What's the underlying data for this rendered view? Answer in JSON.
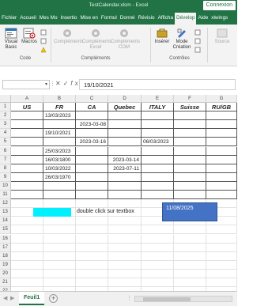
{
  "window": {
    "title": "TestCalendar.xlsm - Excel",
    "connect_label": "Connexion"
  },
  "tabs": [
    "Fichier",
    "Accueil",
    "Mes Mo",
    "Insertio",
    "Mise en",
    "Formul",
    "Donné",
    "Révisio",
    "Afficha",
    "Dévelop",
    "Aide",
    "xlwings"
  ],
  "active_tab": "Dévelop",
  "ribbon": {
    "visual_basic": "Visual Basic",
    "macros": "Macros",
    "group_code": "Code",
    "complements": "Compléments",
    "complements_excel": "Compléments Excel",
    "complements_com": "Compléments COM",
    "group_complements": "Compléments",
    "inserer": "Insérer",
    "mode_creation": "Mode Création",
    "group_controles": "Contrôles",
    "source": "Source"
  },
  "formula_bar": {
    "name_box": "",
    "fx": "fx",
    "value": "19/10/2021"
  },
  "columns": [
    "A",
    "B",
    "C",
    "D",
    "E",
    "F",
    "G"
  ],
  "rows": [
    "1",
    "2",
    "3",
    "4",
    "5",
    "6",
    "7",
    "8",
    "9",
    "10",
    "11",
    "12",
    "13",
    "14",
    "15",
    "16",
    "17",
    "18",
    "19",
    "20",
    "21",
    "22"
  ],
  "table": {
    "headers": [
      "US",
      "FR",
      "CA",
      "Quebec",
      "ITALY",
      "Suisse",
      "RU/GB"
    ],
    "cells": [
      {
        "row": 2,
        "col": 1,
        "value": "13/03/2023"
      },
      {
        "row": 3,
        "col": 2,
        "value": "2023-03-08"
      },
      {
        "row": 4,
        "col": 1,
        "value": "19/10/2021"
      },
      {
        "row": 5,
        "col": 2,
        "value": "2023-03-16"
      },
      {
        "row": 5,
        "col": 4,
        "value": "06/03/2023"
      },
      {
        "row": 6,
        "col": 1,
        "value": "25/03/2023"
      },
      {
        "row": 7,
        "col": 1,
        "value": "16/03/1800"
      },
      {
        "row": 7,
        "col": 3,
        "value": "2023-03-14"
      },
      {
        "row": 8,
        "col": 1,
        "value": "10/03/2022"
      },
      {
        "row": 8,
        "col": 3,
        "value": "2023-07-11"
      },
      {
        "row": 9,
        "col": 1,
        "value": "26/03/1970"
      }
    ]
  },
  "hint_text": "double click  sur textbox",
  "textbox_value": "11/08/2025",
  "sheet_tab": "Feuil1",
  "colors": {
    "excel_green": "#217346",
    "cyan_box": "#00f0ff",
    "textbox_blue": "#4472c4"
  }
}
